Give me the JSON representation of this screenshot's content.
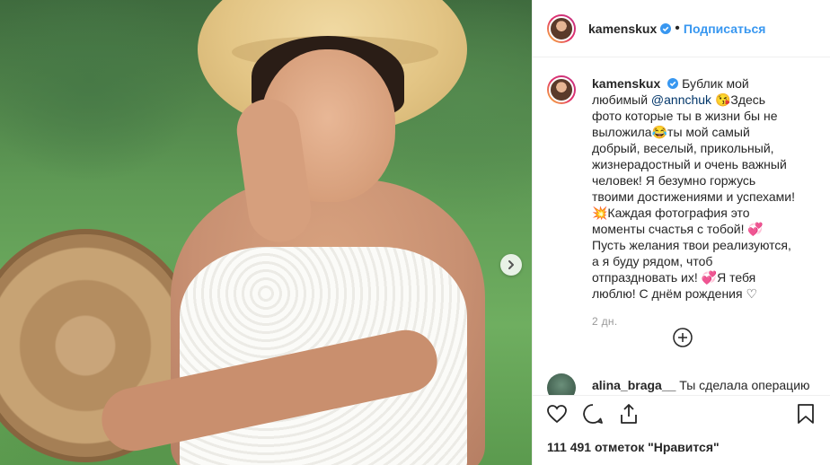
{
  "post": {
    "username": "kamenskux",
    "follow_label": "Подписаться",
    "caption_user": "kamenskux",
    "caption_part1": "Бублик мой любимый",
    "mention": "@annchuk",
    "caption_part2": "😘Здесь фото которые ты в жизни бы не выложила😂ты мой самый добрый, веселый, прикольный, жизнерадостный и очень важный человек! Я безумно горжусь твоими достижениями и успехами! 💥Каждая фотография это моменты счастья с тобой! 💞 Пусть желания твои реализуются, а я буду рядом, чтоб отпраздновать их! 💞Я тебя люблю! С днём рождения ♡",
    "age": "2 дн.",
    "comment": {
      "user": "alina_braga__",
      "text": "Ты сделала операцию"
    },
    "likes": "111 491 отметок \"Нравится\""
  },
  "icons": {
    "next": "chevron-right-icon",
    "verified": "verified-badge-icon",
    "load_more": "plus-circle-icon",
    "like": "heart-icon",
    "comment": "comment-icon",
    "share": "share-icon",
    "save": "bookmark-icon"
  },
  "colors": {
    "link": "#3897f0",
    "mention": "#003569",
    "text": "#262626",
    "muted": "#999999"
  }
}
